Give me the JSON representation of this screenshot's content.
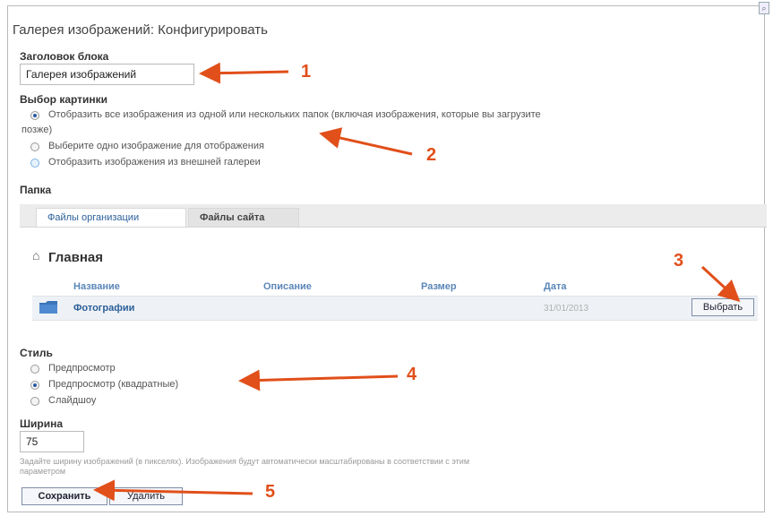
{
  "dialog": {
    "title": "Галерея изображений: Конфигурировать"
  },
  "block_title": {
    "label": "Заголовок блока",
    "value": "Галерея изображений"
  },
  "image_choice": {
    "label": "Выбор картинки",
    "options": [
      {
        "text_line1": "Отобразить все изображения из одной или нескольких папок (включая изображения, которые вы загрузите",
        "text_line2": "позже)",
        "selected": true
      },
      {
        "text": "Выберите одно изображение для отображения",
        "selected": false
      },
      {
        "text": "Отобразить изображения из внешней галереи",
        "selected": false
      }
    ]
  },
  "folder": {
    "label": "Папка",
    "tabs": [
      {
        "label": "Файлы организации",
        "active": true
      },
      {
        "label": "Файлы сайта",
        "active": false
      }
    ],
    "breadcrumb": "Главная",
    "columns": [
      "Название",
      "Описание",
      "Размер",
      "Дата"
    ],
    "rows": [
      {
        "name": "Фотографии",
        "description": "",
        "size": "",
        "date": "31/01/2013",
        "action": "Выбрать"
      }
    ]
  },
  "style": {
    "label": "Стиль",
    "options": [
      {
        "text": "Предпросмотр",
        "selected": false
      },
      {
        "text": "Предпросмотр (квадратные)",
        "selected": true
      },
      {
        "text": "Слайдшоу",
        "selected": false
      }
    ]
  },
  "width": {
    "label": "Ширина",
    "value": "75",
    "hint_line1": "Задайте ширину изображений (в пикселях). Изображения будут автоматически масштабированы в соответствии с этим",
    "hint_line2": "параметром"
  },
  "actions": {
    "save": "Сохранить",
    "delete": "Удалить"
  },
  "annotations": {
    "numbers": [
      "1",
      "2",
      "3",
      "4",
      "5"
    ],
    "color": "#e14f1a"
  },
  "colors": {
    "link": "#2b5f99",
    "header_text": "#5a86b8",
    "row_bg": "#eef1f5"
  }
}
